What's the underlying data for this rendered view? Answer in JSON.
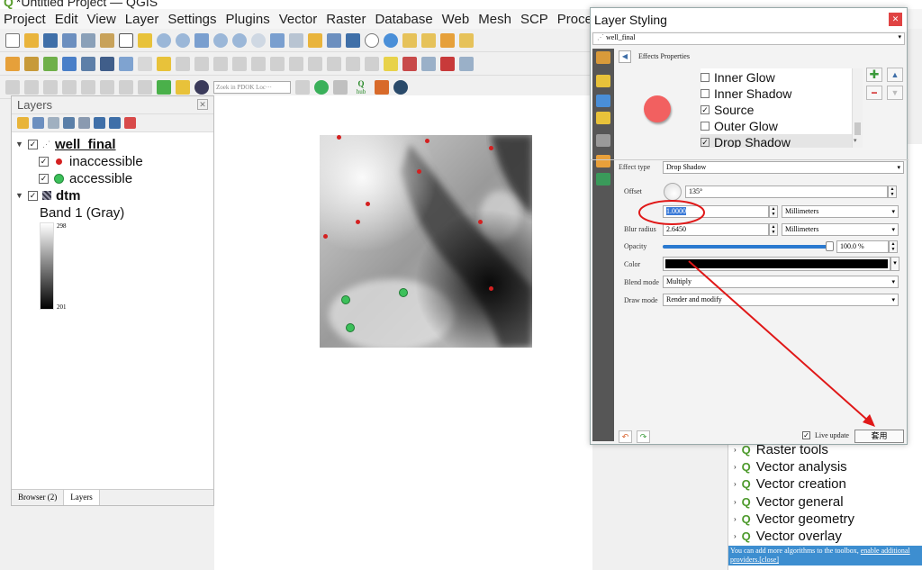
{
  "app": {
    "title": "*Untitled Project — QGIS"
  },
  "menu": [
    "Project",
    "Edit",
    "View",
    "Layer",
    "Settings",
    "Plugins",
    "Vector",
    "Raster",
    "Database",
    "Web",
    "Mesh",
    "SCP",
    "Processin"
  ],
  "toolbar": {
    "search_placeholder": "Zoek in PDOK Loc···",
    "hub_label": "hub"
  },
  "layers_panel": {
    "title": "Layers",
    "tree": [
      {
        "name": "well_final",
        "checked": true,
        "expanded": true
      },
      {
        "name": "inaccessible",
        "checked": true,
        "color": "#d42020"
      },
      {
        "name": "accessible",
        "checked": true,
        "color": "#3cc05a"
      },
      {
        "name": "dtm",
        "checked": true,
        "expanded": true
      },
      {
        "name": "Band 1 (Gray)"
      }
    ],
    "legend_max": "298",
    "legend_min": "201",
    "tabs": [
      "Browser (2)",
      "Layers"
    ]
  },
  "styling_dialog": {
    "title": "Layer Styling",
    "layer": "well_final",
    "section": "Effects Properties",
    "effects": [
      {
        "name": "Inner Glow",
        "checked": false
      },
      {
        "name": "Inner Shadow",
        "checked": false
      },
      {
        "name": "Source",
        "checked": true
      },
      {
        "name": "Outer Glow",
        "checked": false
      },
      {
        "name": "Drop Shadow",
        "checked": true
      }
    ],
    "effect_type_label": "Effect type",
    "effect_type": "Drop Shadow",
    "offset_label": "Offset",
    "offset_angle": "135°",
    "offset_distance": "1.0000",
    "offset_unit": "Millimeters",
    "blur_label": "Blur radius",
    "blur_value": "2.6450",
    "blur_unit": "Millimeters",
    "opacity_label": "Opacity",
    "opacity_value": "100.0 %",
    "opacity_fraction": 1.0,
    "color_label": "Color",
    "shadow_color": "#000000",
    "blend_label": "Blend mode",
    "blend_mode": "Multiply",
    "draw_label": "Draw mode",
    "draw_mode": "Render and modify",
    "live_update": "Live update",
    "apply": "套用"
  },
  "processing": {
    "items": [
      "Raster tools",
      "Vector analysis",
      "Vector creation",
      "Vector general",
      "Vector geometry",
      "Vector overlay"
    ],
    "hint_text": "You can add more algorithms to the toolbox,",
    "hint_link": "enable additional providers.",
    "hint_close": "[close]"
  },
  "annotation_color": "#e01818"
}
